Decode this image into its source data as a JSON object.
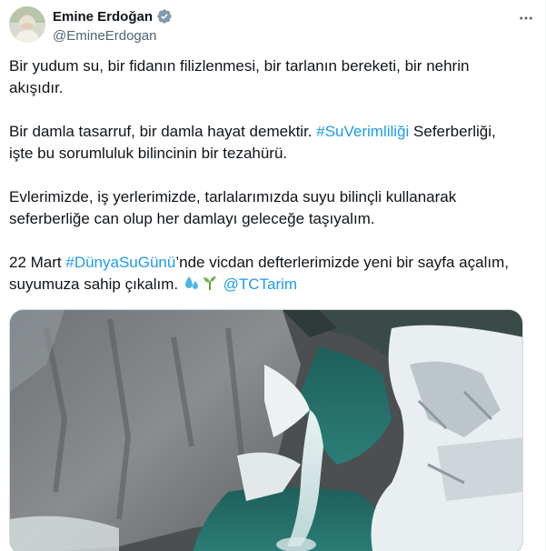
{
  "author": {
    "display_name": "Emine Erdoğan",
    "handle": "@EmineErdogan",
    "verified_icon": "verified-badge-icon"
  },
  "tweet": {
    "p1": "Bir yudum su, bir fidanın filizlenmesi, bir tarlanın bereketi, bir nehrin akışıdır.",
    "p2_before": "Bir damla tasarruf, bir damla hayat demektir. ",
    "p2_tag": "#SuVerimliliği",
    "p2_after": " Seferberliği, işte bu sorumluluk bilincinin bir tezahürü.",
    "p3": "Evlerimizde, iş yerlerimizde, tarlalarımızda suyu bilinçli kullanarak seferberliğe can olup her damlayı geleceğe taşıyalım.",
    "p4_before": "22 Mart ",
    "p4_tag": "#DünyaSuGünü",
    "p4_after": "’nde vicdan defterlerimizde yeni bir sayfa açalım, suyumuza sahip çıkalım. ",
    "p4_mention": "@TCTarim"
  },
  "colors": {
    "link": "#1d9bf0",
    "text": "#0f1419",
    "secondary": "#536471",
    "verified": "#829aab"
  }
}
